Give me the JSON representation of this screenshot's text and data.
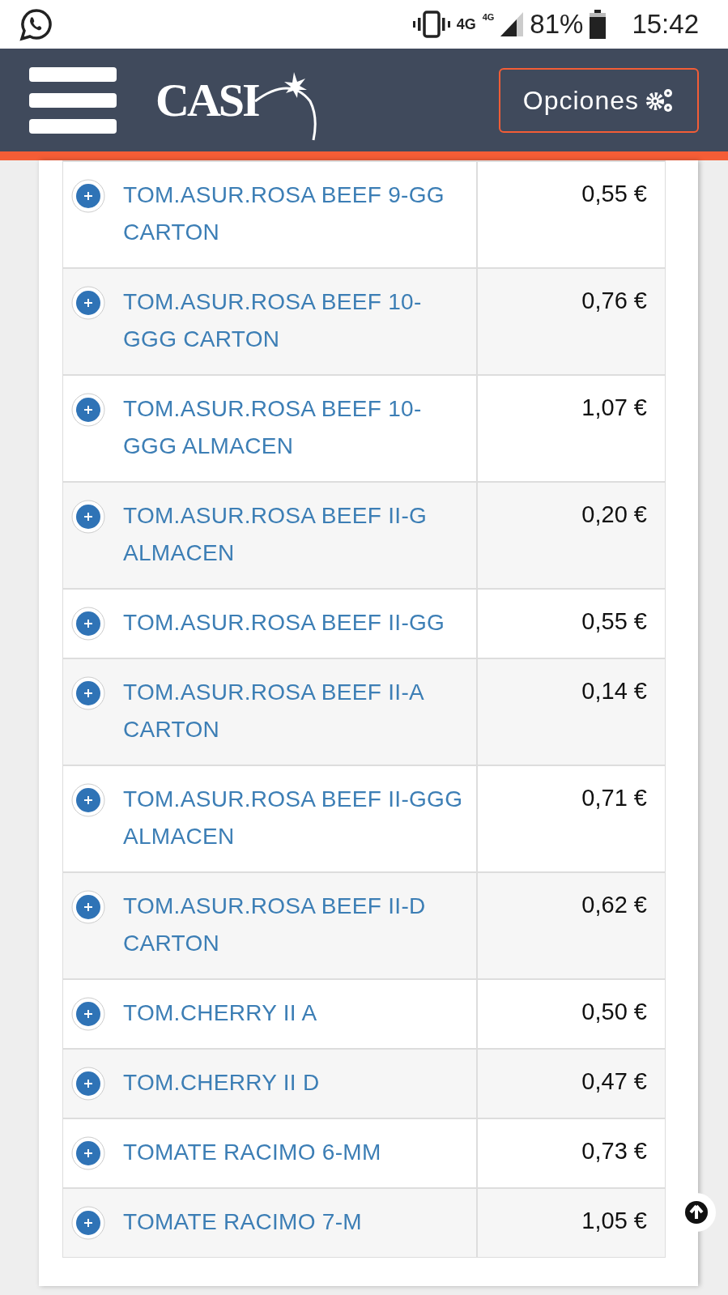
{
  "status_bar": {
    "network": "4G",
    "network_2": "4G",
    "battery": "81%",
    "time": "15:42"
  },
  "header": {
    "logo": "CASI",
    "options_button": "Opciones"
  },
  "rows": [
    {
      "name": "TOM.ASUR.ROSA BEEF 9-GG CARTON",
      "price": "0,55 €"
    },
    {
      "name": "TOM.ASUR.ROSA BEEF 10-GGG CARTON",
      "price": "0,76 €"
    },
    {
      "name": "TOM.ASUR.ROSA BEEF 10-GGG ALMACEN",
      "price": "1,07 €"
    },
    {
      "name": "TOM.ASUR.ROSA BEEF II-G ALMACEN",
      "price": "0,20 €"
    },
    {
      "name": "TOM.ASUR.ROSA BEEF II-GG",
      "price": "0,55 €"
    },
    {
      "name": "TOM.ASUR.ROSA BEEF II-A CARTON",
      "price": "0,14 €"
    },
    {
      "name": "TOM.ASUR.ROSA BEEF II-GGG ALMACEN",
      "price": "0,71 €"
    },
    {
      "name": "TOM.ASUR.ROSA BEEF II-D CARTON",
      "price": "0,62 €"
    },
    {
      "name": "TOM.CHERRY II A",
      "price": "0,50 €"
    },
    {
      "name": "TOM.CHERRY II D",
      "price": "0,47 €"
    },
    {
      "name": "TOMATE RACIMO 6-MM",
      "price": "0,73 €"
    },
    {
      "name": "TOMATE RACIMO 7-M",
      "price": "1,05 €"
    }
  ]
}
